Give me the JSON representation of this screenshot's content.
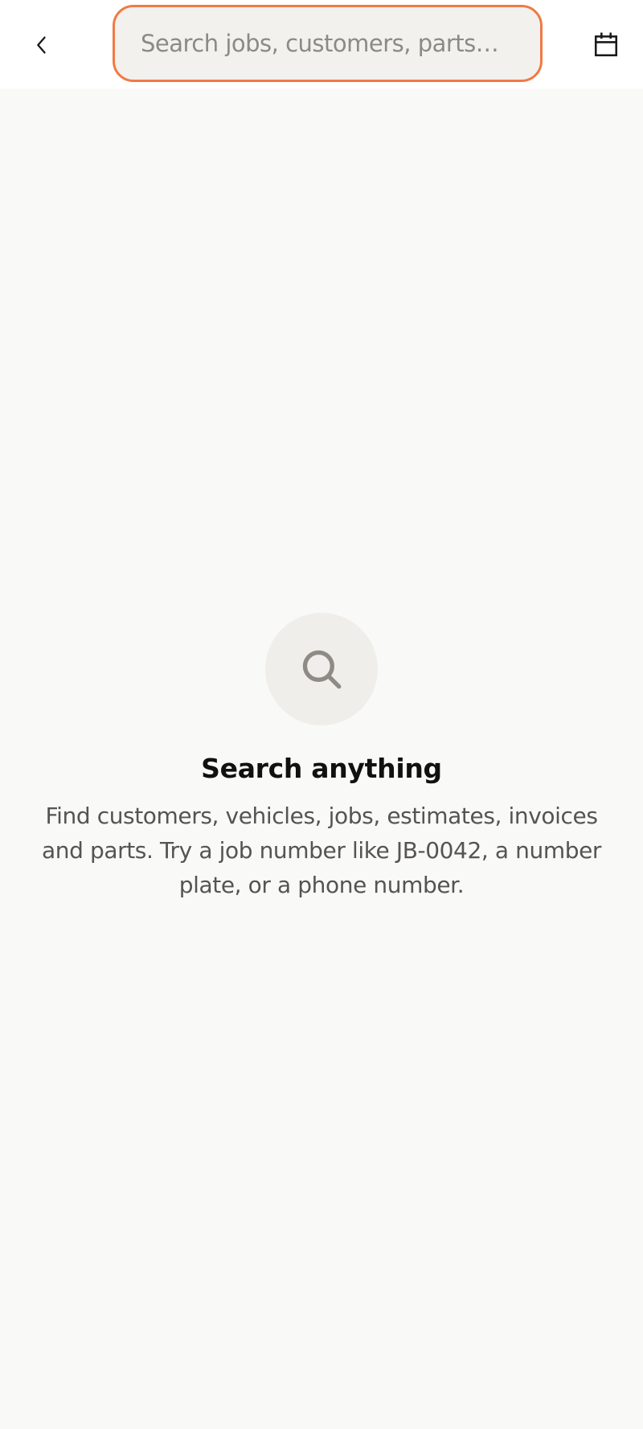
{
  "header": {
    "search": {
      "placeholder": "Search jobs, customers, parts…",
      "value": "",
      "focus_border_color": "#f07a45"
    },
    "back_icon": "chevron-left-icon",
    "calendar_icon": "calendar-icon"
  },
  "empty_state": {
    "icon": "search-icon",
    "title": "Search anything",
    "description": "Find customers, vehicles, jobs, estimates, invoices and parts. Try a job number like JB-0042, a number plate, or a phone number."
  }
}
